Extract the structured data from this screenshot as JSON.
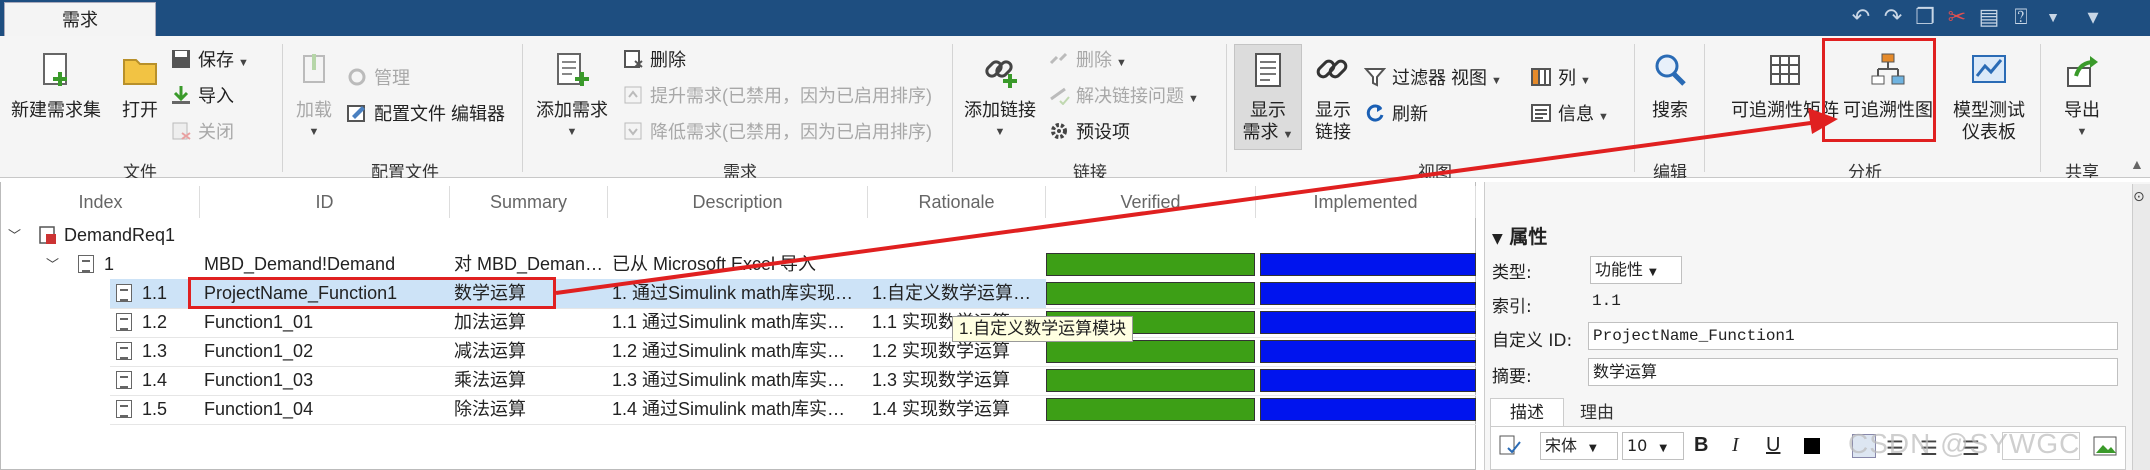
{
  "tab": {
    "active": "需求"
  },
  "ribbon": {
    "file_group": {
      "label": "文件",
      "new_set": "新建需求集",
      "open": "打开",
      "save": "保存",
      "import": "导入",
      "close": "关闭"
    },
    "config_group": {
      "label": "配置文件",
      "load": "加载",
      "manage": "管理",
      "profile_editor": "配置文件 编辑器"
    },
    "req_group": {
      "label": "需求",
      "add_req": "添加需求",
      "delete": "删除",
      "promote": "提升需求(已禁用，因为已启用排序)",
      "demote": "降低需求(已禁用，因为已启用排序)"
    },
    "link_group": {
      "label": "链接",
      "add_link": "添加链接",
      "delete": "删除",
      "resolve": "解决链接问题",
      "preferences": "预设项"
    },
    "view_group": {
      "label": "视图",
      "show_req_l1": "显示",
      "show_req_l2": "需求",
      "show_link_l1": "显示",
      "show_link_l2": "链接",
      "filter_view": "过滤器 视图",
      "columns": "列",
      "refresh": "刷新",
      "info": "信息"
    },
    "edit_group": {
      "label": "编辑",
      "search": "搜索"
    },
    "analysis_group": {
      "label": "分析",
      "trace_matrix": "可追溯性矩阵",
      "trace_diagram": "可追溯性图",
      "dashboard_l1": "模型测试",
      "dashboard_l2": "仪表板"
    },
    "share_group": {
      "label": "共享",
      "export": "导出"
    }
  },
  "table": {
    "headers": [
      "Index",
      "ID",
      "Summary",
      "Description",
      "Rationale",
      "Verified",
      "Implemented"
    ],
    "root": {
      "index": "DemandReq1"
    },
    "group": {
      "index": "1",
      "id": "MBD_Demand!Demand",
      "summary": "对 MBD_Deman…",
      "description": "已从 Microsoft Excel 导入"
    },
    "rows": [
      {
        "index": "1.1",
        "id": "ProjectName_Function1",
        "summary": "数学运算",
        "description": "1. 通过Simulink math库实现…",
        "rationale": "1.自定义数学运算…"
      },
      {
        "index": "1.2",
        "id": "Function1_01",
        "summary": "加法运算",
        "description": "1.1 通过Simulink math库实…",
        "rationale": "1.1 实现数学运算"
      },
      {
        "index": "1.3",
        "id": "Function1_02",
        "summary": "减法运算",
        "description": "1.2 通过Simulink math库实…",
        "rationale": "1.2 实现数学运算"
      },
      {
        "index": "1.4",
        "id": "Function1_03",
        "summary": "乘法运算",
        "description": "1.3 通过Simulink math库实…",
        "rationale": "1.3 实现数学运算"
      },
      {
        "index": "1.5",
        "id": "Function1_04",
        "summary": "除法运算",
        "description": "1.4 通过Simulink math库实…",
        "rationale": "1.4 实现数学运算"
      }
    ],
    "tooltip": "1.自定义数学运算模块"
  },
  "properties": {
    "title": "属性",
    "type_label": "类型:",
    "type_value": "功能性",
    "index_label": "索引:",
    "index_value": "1.1",
    "custom_id_label": "自定义 ID:",
    "custom_id_value": "ProjectName_Function1",
    "summary_label": "摘要:",
    "summary_value": "数学运算",
    "tab_desc": "描述",
    "tab_reason": "理由",
    "font_name": "宋体",
    "font_size": "10"
  },
  "watermark": "CSDN @SYWGC",
  "colors": {
    "verified": "#3d9f16",
    "implemented": "#0014ee",
    "highlight": "#e02020",
    "titlebar": "#1e4e80"
  }
}
